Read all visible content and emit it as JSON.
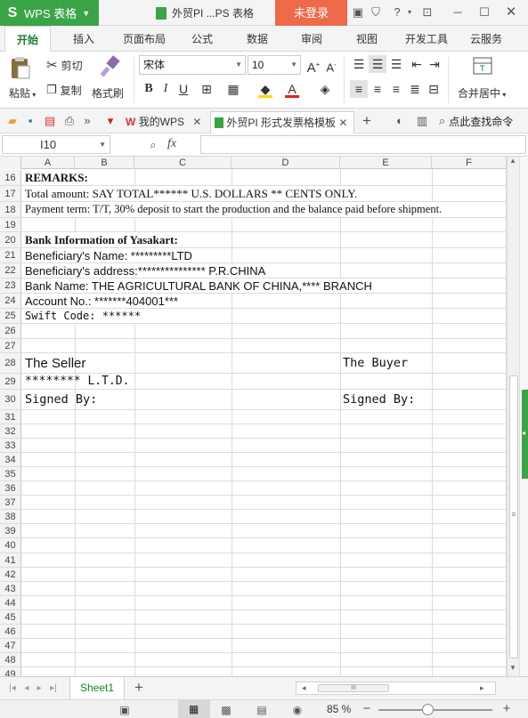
{
  "titlebar": {
    "app_name": "WPS 表格",
    "doc_title": "外贸PI ...PS 表格",
    "login_label": "未登录"
  },
  "ribbon_tabs": [
    {
      "label": "开始",
      "active": true
    },
    {
      "label": "插入"
    },
    {
      "label": "页面布局"
    },
    {
      "label": "公式"
    },
    {
      "label": "数据"
    },
    {
      "label": "审阅"
    },
    {
      "label": "视图"
    },
    {
      "label": "开发工具"
    },
    {
      "label": "云服务"
    }
  ],
  "ribbon": {
    "paste_label": "粘贴",
    "cut_label": "剪切",
    "copy_label": "复制",
    "format_painter_label": "格式刷",
    "font_name": "宋体",
    "font_size": "10",
    "merge_center_label": "合并居中"
  },
  "quickbar": {
    "tab_mywps": "我的WPS",
    "tab_doc": "外贸PI 形式发票格模板",
    "find_command": "点此查找命令"
  },
  "formula": {
    "cell_ref": "I10",
    "fx_label": "fx",
    "value": ""
  },
  "columns": [
    "A",
    "B",
    "C",
    "D",
    "E",
    "F"
  ],
  "rows": {
    "r16": {
      "num": "16",
      "a": "REMARKS:"
    },
    "r17": {
      "num": "17",
      "a": "Total amount: SAY TOTAL****** U.S. DOLLARS ** CENTS ONLY."
    },
    "r18": {
      "num": "18",
      "a": "Payment term: T/T, 30% deposit to start the production and the balance  paid before shipment."
    },
    "r19": {
      "num": "19"
    },
    "r20": {
      "num": "20",
      "a": "Bank Information of Yasakart:"
    },
    "r21": {
      "num": "21",
      "a": "Beneficiary's Name: *********LTD"
    },
    "r22": {
      "num": "22",
      "a": "Beneficiary's address:*************** P.R.CHINA"
    },
    "r23": {
      "num": "23",
      "a": "Bank Name: THE AGRICULTURAL BANK OF CHINA,**** BRANCH"
    },
    "r24": {
      "num": "24",
      "a": "Account No.: *******404001***"
    },
    "r25": {
      "num": "25",
      "a": "Swift Code: ******"
    },
    "r26": {
      "num": "26"
    },
    "r27": {
      "num": "27"
    },
    "r28": {
      "num": "28",
      "a": "The Seller",
      "e": "The Buyer"
    },
    "r29": {
      "num": "29",
      "a": "******** L.T.D."
    },
    "r30": {
      "num": "30",
      "a": "Signed By:",
      "e": "Signed By:"
    },
    "r31": {
      "num": "31"
    },
    "r32": {
      "num": "32"
    },
    "r33": {
      "num": "33"
    },
    "r34": {
      "num": "34"
    },
    "r35": {
      "num": "35"
    },
    "r36": {
      "num": "36"
    },
    "r37": {
      "num": "37"
    },
    "r38": {
      "num": "38"
    },
    "r39": {
      "num": "39"
    },
    "r40": {
      "num": "40"
    },
    "r41": {
      "num": "41"
    },
    "r42": {
      "num": "42"
    },
    "r43": {
      "num": "43"
    },
    "r44": {
      "num": "44"
    },
    "r45": {
      "num": "45"
    },
    "r46": {
      "num": "46"
    },
    "r47": {
      "num": "47"
    },
    "r48": {
      "num": "48"
    },
    "r49": {
      "num": "49"
    }
  },
  "sheetbar": {
    "sheet_name": "Sheet1",
    "hscroll_grip": "III"
  },
  "statusbar": {
    "zoom": "85 %"
  },
  "colors": {
    "brand_green": "#3aa447",
    "login_orange": "#ef6a49"
  }
}
